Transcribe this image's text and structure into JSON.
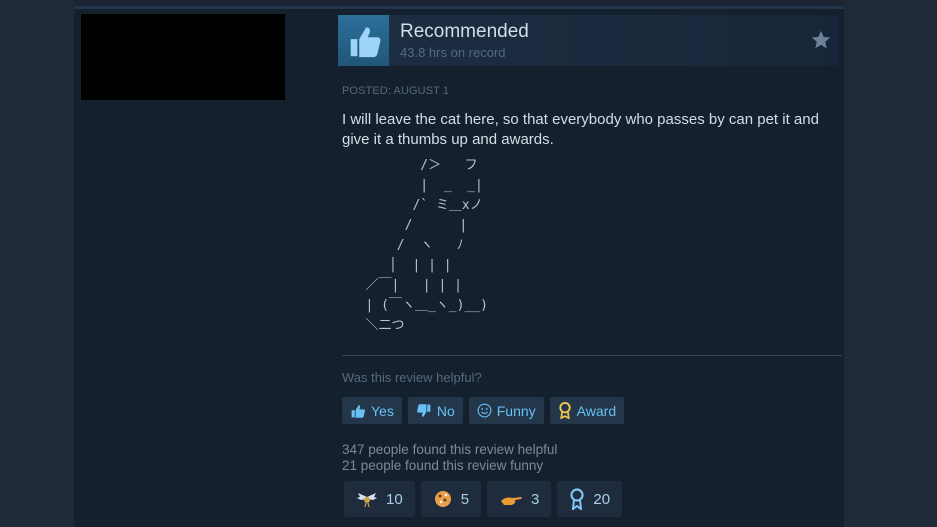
{
  "review": {
    "verdict": "Recommended",
    "hours": "43.8 hrs on record",
    "posted": "POSTED: AUGUST 1",
    "text": "I will leave the cat here, so that everybody who passes by can pet it and give it a thumbs up and awards.",
    "ascii_art": "          /＞   フ\n          |  _  _|\n         /` ミ＿xノ\n        /      |\n       /  ヽ   ﾉ\n      │  | | |\n   ／￣|   | | |\n   | (￣ヽ＿_ヽ_)__)\n   ＼二つ"
  },
  "feedback": {
    "question": "Was this review helpful?",
    "buttons": [
      {
        "label": "Yes",
        "icon": "thumbs-up-icon"
      },
      {
        "label": "No",
        "icon": "thumbs-down-icon"
      },
      {
        "label": "Funny",
        "icon": "smiley-icon"
      },
      {
        "label": "Award",
        "icon": "award-ribbon-icon"
      }
    ],
    "helpful_count": "347 people found this review helpful",
    "funny_count": "21 people found this review funny"
  },
  "awards": [
    {
      "icon": "winged-award-icon",
      "count": "10"
    },
    {
      "icon": "cookie-award-icon",
      "count": "5"
    },
    {
      "icon": "pointing-hand-award-icon",
      "count": "3"
    },
    {
      "icon": "ribbon-award-icon",
      "count": "20"
    }
  ],
  "colors": {
    "accent": "#67c1f5",
    "background": "#15202e",
    "thumb_box": "#2c6f99"
  }
}
